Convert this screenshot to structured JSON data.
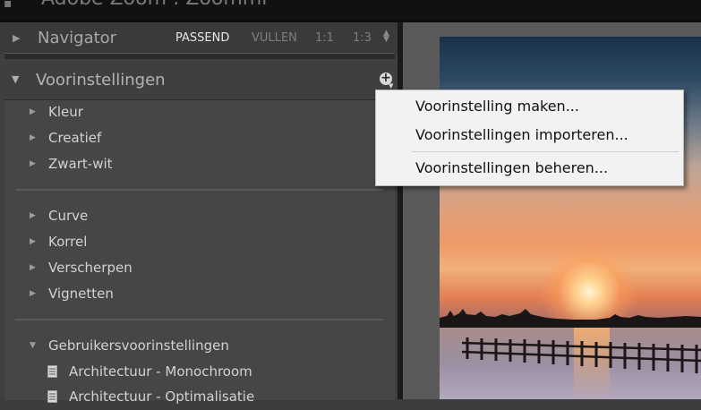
{
  "app": {
    "title": "Adobe Zoom : Zoommi"
  },
  "navigator": {
    "title": "Navigator",
    "zoom_options": [
      "PASSEND",
      "VULLEN",
      "1:1",
      "1:3"
    ],
    "active_zoom": "PASSEND"
  },
  "presets": {
    "title": "Voorinstellingen",
    "groups_a": [
      "Kleur",
      "Creatief",
      "Zwart-wit"
    ],
    "groups_b": [
      "Curve",
      "Korrel",
      "Verscherpen",
      "Vignetten"
    ],
    "user_group": "Gebruikersvoorinstellingen",
    "user_presets": [
      "Architectuur - Monochroom",
      "Architectuur - Optimalisatie"
    ]
  },
  "context_menu": {
    "items": [
      "Voorinstelling maken...",
      "Voorinstellingen importeren...",
      "Voorinstellingen beheren..."
    ]
  },
  "icons": {
    "expand": "triangle-right-icon",
    "collapse": "triangle-down-icon",
    "add": "plus-circle-icon",
    "preset": "document-icon"
  }
}
